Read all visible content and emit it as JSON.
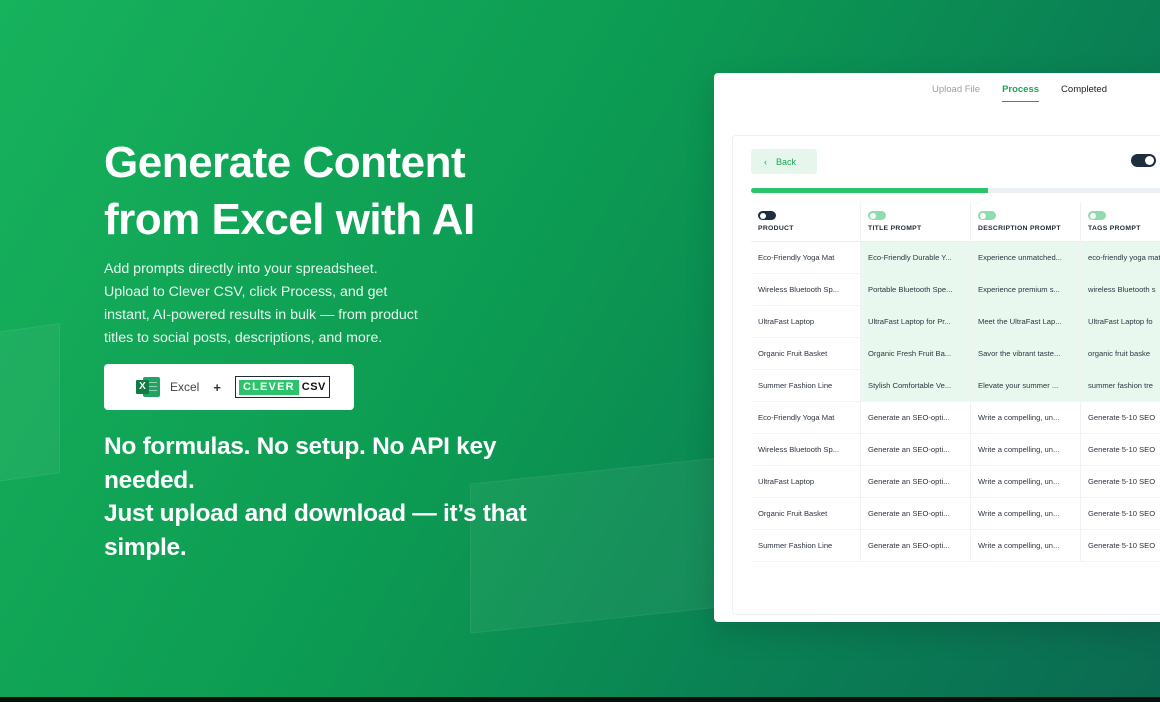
{
  "hero": {
    "title": "Generate Content\nfrom Excel with AI",
    "description": "Add prompts directly into your spreadsheet.\nUpload to Clever CSV, click Process, and get\ninstant, AI-powered results in bulk — from product\ntitles to social posts, descriptions, and more.",
    "excel_label": "Excel",
    "excel_icon_letter": "X",
    "plus": "+",
    "brand_clever": "CLEVER",
    "brand_csv": "CSV",
    "tagline": "No formulas. No setup. No API key\nneeded.\nJust upload and download — it’s that\nsimple."
  },
  "panel": {
    "steps": [
      {
        "label": "Upload File",
        "state": "pending"
      },
      {
        "label": "Process",
        "state": "active"
      },
      {
        "label": "Completed",
        "state": "done"
      }
    ],
    "back_label": "Back",
    "back_icon": "chevron-left-icon",
    "back_glyph": "‹",
    "progress": 0.55,
    "columns": [
      "PRODUCT",
      "TITLE PROMPT",
      "DESCRIPTION PROMPT",
      "TAGS PROMPT"
    ],
    "rows": [
      [
        "Eco-Friendly Yoga Mat",
        "Eco-Friendly Durable Y...",
        "Experience unmatched...",
        "eco-friendly yoga mat"
      ],
      [
        "Wireless Bluetooth Sp...",
        "Portable Bluetooth Spe...",
        "Experience premium s...",
        "wireless Bluetooth s"
      ],
      [
        "UltraFast Laptop",
        "UltraFast Laptop for Pr...",
        "Meet the UltraFast Lap...",
        "UltraFast Laptop fo"
      ],
      [
        "Organic Fruit Basket",
        "Organic Fresh Fruit Ba...",
        "Savor the vibrant taste...",
        "organic fruit baske"
      ],
      [
        "Summer Fashion Line",
        "Stylish Comfortable Ve...",
        "Elevate your summer ...",
        "summer fashion tre"
      ],
      [
        "Eco-Friendly Yoga Mat",
        "Generate an SEO-opti...",
        "Write a compelling, un...",
        "Generate 5-10 SEO"
      ],
      [
        "Wireless Bluetooth Sp...",
        "Generate an SEO-opti...",
        "Write a compelling, un...",
        "Generate 5-10 SEO"
      ],
      [
        "UltraFast Laptop",
        "Generate an SEO-opti...",
        "Write a compelling, un...",
        "Generate 5-10 SEO"
      ],
      [
        "Organic Fruit Basket",
        "Generate an SEO-opti...",
        "Write a compelling, un...",
        "Generate 5-10 SEO"
      ],
      [
        "Summer Fashion Line",
        "Generate an SEO-opti...",
        "Write a compelling, un...",
        "Generate 5-10 SEO"
      ]
    ],
    "generated_rows": 5
  },
  "colors": {
    "brand_green": "#2cc46a",
    "accent": "#1fa45a",
    "generated_cell": "#e9f8ee",
    "toggle_dark": "#1e2e3e"
  }
}
